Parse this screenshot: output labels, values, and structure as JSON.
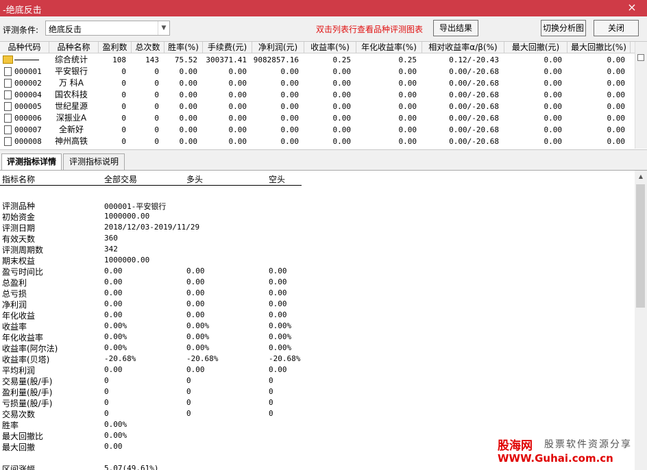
{
  "window": {
    "title": "-绝底反击",
    "close_glyph": "×"
  },
  "toolbar": {
    "condition_label": "评测条件:",
    "condition_value": "绝底反击",
    "hint": "双击列表行查看品种评测图表",
    "export_label": "导出结果",
    "switch_label": "切换分析图",
    "close_label": "关闭"
  },
  "table": {
    "headers": [
      "品种代码",
      "品种名称",
      "盈利数",
      "总次数",
      "胜率(%)",
      "手续费(元)",
      "净利润(元)",
      "收益率(%)",
      "年化收益率(%)",
      "相对收益率α/β(%)",
      "最大回撤(元)",
      "最大回撤比(%)"
    ],
    "rows": [
      {
        "code": "",
        "name": "综合统计",
        "win": "108",
        "total": "143",
        "rate": "75.52",
        "fee": "300371.41",
        "net": "9082857.16",
        "ret": "0.25",
        "annual": "0.25",
        "rel": "0.12/-20.43",
        "dd": "0.00",
        "ddr": "0.00"
      },
      {
        "code": "000001",
        "name": "平安银行",
        "win": "0",
        "total": "0",
        "rate": "0.00",
        "fee": "0.00",
        "net": "0.00",
        "ret": "0.00",
        "annual": "0.00",
        "rel": "0.00/-20.68",
        "dd": "0.00",
        "ddr": "0.00"
      },
      {
        "code": "000002",
        "name": "万 科A",
        "win": "0",
        "total": "0",
        "rate": "0.00",
        "fee": "0.00",
        "net": "0.00",
        "ret": "0.00",
        "annual": "0.00",
        "rel": "0.00/-20.68",
        "dd": "0.00",
        "ddr": "0.00"
      },
      {
        "code": "000004",
        "name": "国农科技",
        "win": "0",
        "total": "0",
        "rate": "0.00",
        "fee": "0.00",
        "net": "0.00",
        "ret": "0.00",
        "annual": "0.00",
        "rel": "0.00/-20.68",
        "dd": "0.00",
        "ddr": "0.00"
      },
      {
        "code": "000005",
        "name": "世纪星源",
        "win": "0",
        "total": "0",
        "rate": "0.00",
        "fee": "0.00",
        "net": "0.00",
        "ret": "0.00",
        "annual": "0.00",
        "rel": "0.00/-20.68",
        "dd": "0.00",
        "ddr": "0.00"
      },
      {
        "code": "000006",
        "name": "深振业A",
        "win": "0",
        "total": "0",
        "rate": "0.00",
        "fee": "0.00",
        "net": "0.00",
        "ret": "0.00",
        "annual": "0.00",
        "rel": "0.00/-20.68",
        "dd": "0.00",
        "ddr": "0.00"
      },
      {
        "code": "000007",
        "name": "全新好",
        "win": "0",
        "total": "0",
        "rate": "0.00",
        "fee": "0.00",
        "net": "0.00",
        "ret": "0.00",
        "annual": "0.00",
        "rel": "0.00/-20.68",
        "dd": "0.00",
        "ddr": "0.00"
      },
      {
        "code": "000008",
        "name": "神州高铁",
        "win": "0",
        "total": "0",
        "rate": "0.00",
        "fee": "0.00",
        "net": "0.00",
        "ret": "0.00",
        "annual": "0.00",
        "rel": "0.00/-20.68",
        "dd": "0.00",
        "ddr": "0.00"
      }
    ]
  },
  "tabs": [
    "评测指标详情",
    "评测指标说明"
  ],
  "details": {
    "headers": [
      "指标名称",
      "全部交易",
      "多头",
      "空头"
    ],
    "rows": [
      {
        "label": "",
        "all": "",
        "long": "",
        "short": ""
      },
      {
        "label": "评测品种",
        "all": "000001-平安银行",
        "long": "",
        "short": ""
      },
      {
        "label": "初始资金",
        "all": "1000000.00",
        "long": "",
        "short": ""
      },
      {
        "label": "评测日期",
        "all": "2018/12/03-2019/11/29",
        "long": "",
        "short": ""
      },
      {
        "label": "有效天数",
        "all": "360",
        "long": "",
        "short": ""
      },
      {
        "label": "评测周期数",
        "all": "342",
        "long": "",
        "short": ""
      },
      {
        "label": "期末权益",
        "all": "1000000.00",
        "long": "",
        "short": ""
      },
      {
        "label": "盈亏时间比",
        "all": "0.00",
        "long": "0.00",
        "short": "0.00"
      },
      {
        "label": "总盈利",
        "all": "0.00",
        "long": "0.00",
        "short": "0.00"
      },
      {
        "label": "总亏损",
        "all": "0.00",
        "long": "0.00",
        "short": "0.00"
      },
      {
        "label": "净利润",
        "all": "0.00",
        "long": "0.00",
        "short": "0.00"
      },
      {
        "label": "年化收益",
        "all": "0.00",
        "long": "0.00",
        "short": "0.00"
      },
      {
        "label": "收益率",
        "all": "0.00%",
        "long": "0.00%",
        "short": "0.00%"
      },
      {
        "label": "年化收益率",
        "all": "0.00%",
        "long": "0.00%",
        "short": "0.00%"
      },
      {
        "label": "收益率(阿尔法)",
        "all": "0.00%",
        "long": "0.00%",
        "short": "0.00%"
      },
      {
        "label": "收益率(贝塔)",
        "all": "-20.68%",
        "long": "-20.68%",
        "short": "-20.68%"
      },
      {
        "label": "平均利润",
        "all": "0.00",
        "long": "0.00",
        "short": "0.00"
      },
      {
        "label": "交易量(股/手)",
        "all": "0",
        "long": "0",
        "short": "0"
      },
      {
        "label": "盈利量(股/手)",
        "all": "0",
        "long": "0",
        "short": "0"
      },
      {
        "label": "亏损量(股/手)",
        "all": "0",
        "long": "0",
        "short": "0"
      },
      {
        "label": "交易次数",
        "all": "0",
        "long": "0",
        "short": "0"
      },
      {
        "label": "胜率",
        "all": "0.00%",
        "long": "",
        "short": ""
      },
      {
        "label": "最大回撤比",
        "all": "0.00%",
        "long": "",
        "short": ""
      },
      {
        "label": "最大回撤",
        "all": "0.00",
        "long": "",
        "short": ""
      },
      {
        "label": "",
        "all": "",
        "long": "",
        "short": ""
      },
      {
        "label": "区间涨幅",
        "all": "5.07(49.61%)",
        "long": "",
        "short": ""
      }
    ]
  },
  "watermark": {
    "logo": "股海网",
    "tagline": "股票软件资源分享",
    "url": "WWW.Guhai.com.cn"
  }
}
